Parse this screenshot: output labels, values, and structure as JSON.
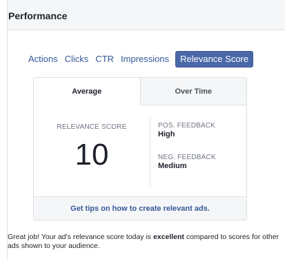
{
  "header": {
    "title": "Performance"
  },
  "tabs": [
    {
      "label": "Actions"
    },
    {
      "label": "Clicks"
    },
    {
      "label": "CTR"
    },
    {
      "label": "Impressions"
    },
    {
      "label": "Relevance Score"
    }
  ],
  "card": {
    "subtabs": {
      "average": "Average",
      "over_time": "Over Time"
    },
    "score_label": "RELEVANCE SCORE",
    "score_value": "10",
    "positive_feedback": {
      "label": "POS. FEEDBACK",
      "value": "High"
    },
    "negative_feedback": {
      "label": "NEG. FEEDBACK",
      "value": "Medium"
    },
    "tips_link": "Get tips on how to create relevant ads."
  },
  "summary": {
    "prefix": "Great job! Your ad's relevance score today is ",
    "emphasis": "excellent",
    "suffix": " compared to scores for other ads shown to your audience."
  },
  "colors": {
    "accent": "#4a68a8",
    "link": "#365899",
    "border": "#dddfe2"
  }
}
